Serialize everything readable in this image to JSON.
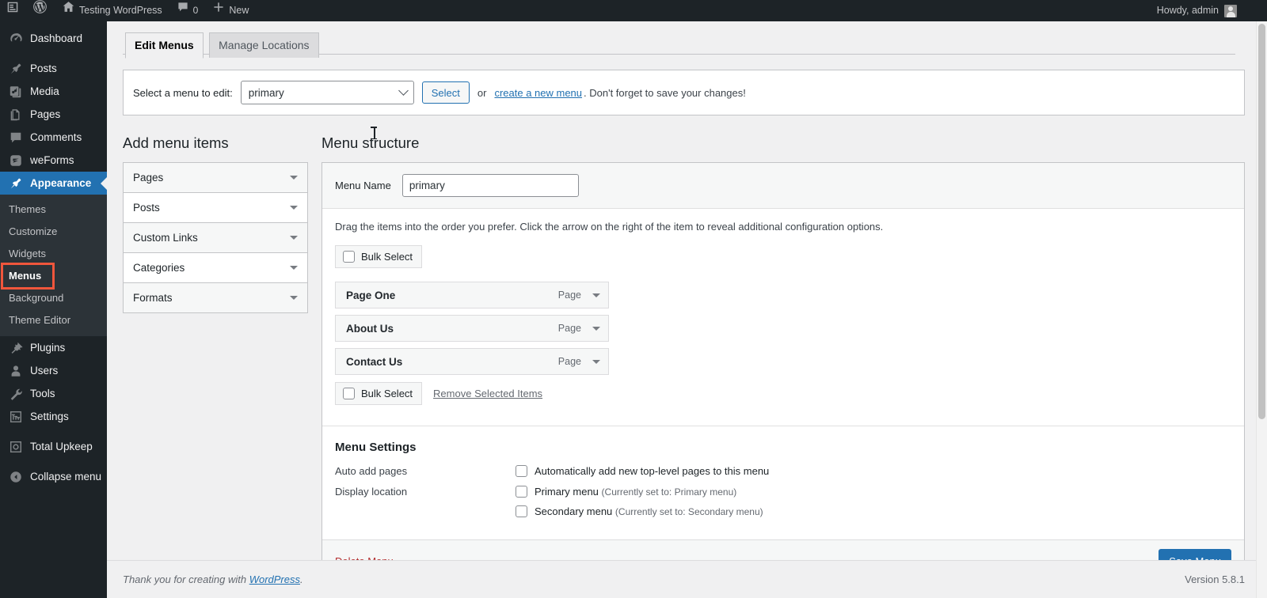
{
  "adminbar": {
    "logo_icon": "wordpress-logo-icon",
    "items": [
      {
        "icon": "wp-menu-icon",
        "label": ""
      },
      {
        "icon": "wordpress-logo-icon",
        "label": ""
      },
      {
        "icon": "home-icon",
        "label": "Testing WordPress"
      },
      {
        "icon": "comment-bubble-icon",
        "label": "0"
      },
      {
        "icon": "plus-icon",
        "label": "New"
      }
    ],
    "site_name": "Testing WordPress",
    "comments_count": "0",
    "new_label": "New",
    "howdy": "Howdy, admin"
  },
  "sidebar": {
    "items": [
      {
        "label": "Dashboard",
        "icon": "dashboard-icon"
      },
      {
        "label": "Posts",
        "icon": "pin-icon"
      },
      {
        "label": "Media",
        "icon": "media-icon"
      },
      {
        "label": "Pages",
        "icon": "pages-icon"
      },
      {
        "label": "Comments",
        "icon": "comment-icon"
      },
      {
        "label": "weForms",
        "icon": "weforms-icon"
      },
      {
        "label": "Appearance",
        "icon": "appearance-brush-icon",
        "current": true
      },
      {
        "label": "Plugins",
        "icon": "plugins-icon"
      },
      {
        "label": "Users",
        "icon": "users-icon"
      },
      {
        "label": "Tools",
        "icon": "tools-wrench-icon"
      },
      {
        "label": "Settings",
        "icon": "settings-icon"
      },
      {
        "label": "Total Upkeep",
        "icon": "total-upkeep-icon"
      },
      {
        "label": "Collapse menu",
        "icon": "collapse-arrow-icon"
      }
    ],
    "submenu": [
      {
        "label": "Themes"
      },
      {
        "label": "Customize"
      },
      {
        "label": "Widgets"
      },
      {
        "label": "Menus",
        "current": true,
        "highlighted": true
      },
      {
        "label": "Background"
      },
      {
        "label": "Theme Editor"
      }
    ],
    "highlight_color": "#f0563c",
    "accent_color": "#2271b1"
  },
  "tabs": [
    {
      "label": "Edit Menus",
      "active": true
    },
    {
      "label": "Manage Locations",
      "active": false
    }
  ],
  "menu_select": {
    "label": "Select a menu to edit:",
    "selected": "primary",
    "options": [
      "primary"
    ],
    "button": "Select",
    "or_text": "or",
    "create_link": "create a new menu",
    "hint_after": ". Don't forget to save your changes!"
  },
  "add_menu_items": {
    "heading": "Add menu items",
    "accordion": [
      {
        "label": "Pages"
      },
      {
        "label": "Posts"
      },
      {
        "label": "Custom Links"
      },
      {
        "label": "Categories"
      },
      {
        "label": "Formats"
      }
    ]
  },
  "menu_structure": {
    "heading": "Menu structure",
    "name_label": "Menu Name",
    "name_value": "primary",
    "drag_hint": "Drag the items into the order you prefer. Click the arrow on the right of the item to reveal additional configuration options.",
    "bulk_select_top": "Bulk Select",
    "bulk_select_bottom": "Bulk Select",
    "remove_selected": "Remove Selected Items",
    "items": [
      {
        "title": "Page One",
        "type": "Page"
      },
      {
        "title": "About Us",
        "type": "Page"
      },
      {
        "title": "Contact Us",
        "type": "Page"
      }
    ]
  },
  "menu_settings": {
    "heading": "Menu Settings",
    "auto_add_label": "Auto add pages",
    "auto_add_option": "Automatically add new top-level pages to this menu",
    "display_location_label": "Display location",
    "locations": [
      {
        "name": "Primary menu",
        "note": "(Currently set to: Primary menu)"
      },
      {
        "name": "Secondary menu",
        "note": "(Currently set to: Secondary menu)"
      }
    ]
  },
  "panel_footer": {
    "delete": "Delete Menu",
    "save": "Save Menu"
  },
  "footer": {
    "thanks_pre": "Thank you for creating with ",
    "thanks_link": "WordPress",
    "thanks_post": ".",
    "version": "Version 5.8.1"
  }
}
